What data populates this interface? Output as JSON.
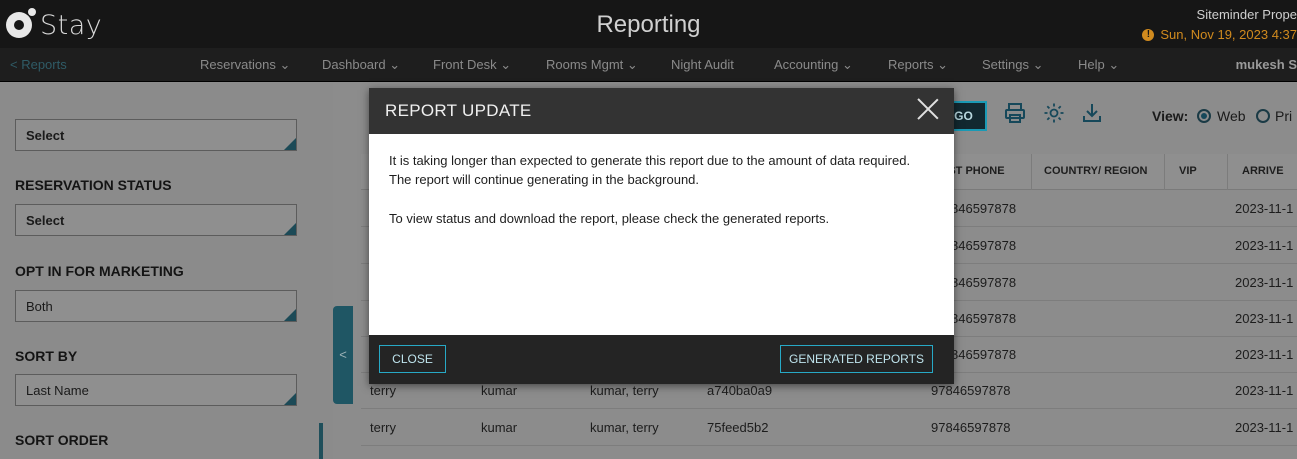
{
  "header": {
    "brand": "Stay",
    "title": "Reporting",
    "property": "Siteminder Prope",
    "datetime": "Sun, Nov 19, 2023 4:37",
    "warning_icon": "alert-circle-icon",
    "warning_color": "#d08a1e"
  },
  "nav": {
    "back": "< Reports",
    "items": [
      "Reservations",
      "Dashboard",
      "Front Desk",
      "Rooms Mgmt",
      "Night Audit",
      "Accounting",
      "Reports",
      "Settings",
      "Help"
    ],
    "dropdown_marker": "⌄",
    "user": "mukesh S"
  },
  "sidebar": {
    "top_select": "Select",
    "filters": [
      {
        "label": "RESERVATION STATUS",
        "value": "Select"
      },
      {
        "label": "OPT IN FOR MARKETING",
        "value": "Both"
      },
      {
        "label": "SORT BY",
        "value": "Last Name"
      },
      {
        "label": "SORT ORDER",
        "value": ""
      }
    ],
    "collapse": "<"
  },
  "toolbar": {
    "go": "GO",
    "icons": [
      "print-icon",
      "settings-icon",
      "download-icon"
    ],
    "view_label": "View:",
    "view_options": [
      {
        "label": "Web",
        "selected": true
      },
      {
        "label": "Pri",
        "selected": false
      }
    ],
    "accent": "#1a9ab5"
  },
  "table": {
    "columns": [
      "EST PHONE",
      "COUNTRY/ REGION",
      "VIP",
      "ARRIVE"
    ],
    "rows": [
      {
        "first": "",
        "last": "",
        "name": "",
        "id": "",
        "phone": "846597878",
        "arrive": "2023-11-1"
      },
      {
        "first": "",
        "last": "",
        "name": "",
        "id": "",
        "phone": "846597878",
        "arrive": "2023-11-1"
      },
      {
        "first": "",
        "last": "",
        "name": "",
        "id": "",
        "phone": "846597878",
        "arrive": "2023-11-1"
      },
      {
        "first": "",
        "last": "",
        "name": "",
        "id": "",
        "phone": "846597878",
        "arrive": "2023-11-1"
      },
      {
        "first": "",
        "last": "",
        "name": "",
        "id": "",
        "phone": "846597878",
        "arrive": "2023-11-1"
      },
      {
        "first": "terry",
        "last": "kumar",
        "name": "kumar, terry",
        "id": "a740ba0a9",
        "phone": "97846597878",
        "arrive": "2023-11-1"
      },
      {
        "first": "terry",
        "last": "kumar",
        "name": "kumar, terry",
        "id": "75feed5b2",
        "phone": "97846597878",
        "arrive": "2023-11-1"
      }
    ]
  },
  "modal": {
    "title": "REPORT UPDATE",
    "line1": "It is taking longer than expected to generate this report due to the amount of data required.",
    "line2": "The report will continue generating in the background.",
    "line3": "To view status and download the report, please check the generated reports.",
    "close_button": "CLOSE",
    "generated_button": "GENERATED REPORTS"
  }
}
